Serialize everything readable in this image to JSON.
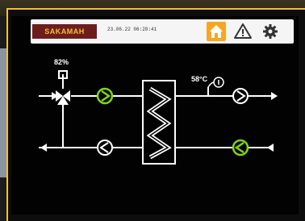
{
  "header": {
    "logo_text": "SAKAMAH",
    "datetime": "23.06.22 06:20:41",
    "icons": [
      "home-icon",
      "warning-icon",
      "gear-icon"
    ]
  },
  "diagram": {
    "valve_opening": "82%",
    "supply_temperature": "58°C",
    "sensor_symbol": "t"
  },
  "colors": {
    "accent_orange": "#f5a623",
    "pump_active_green": "#7ed321",
    "line_white": "#ffffff",
    "header_bg": "#f5f5f5",
    "logo_bg": "#6e1d1d"
  }
}
